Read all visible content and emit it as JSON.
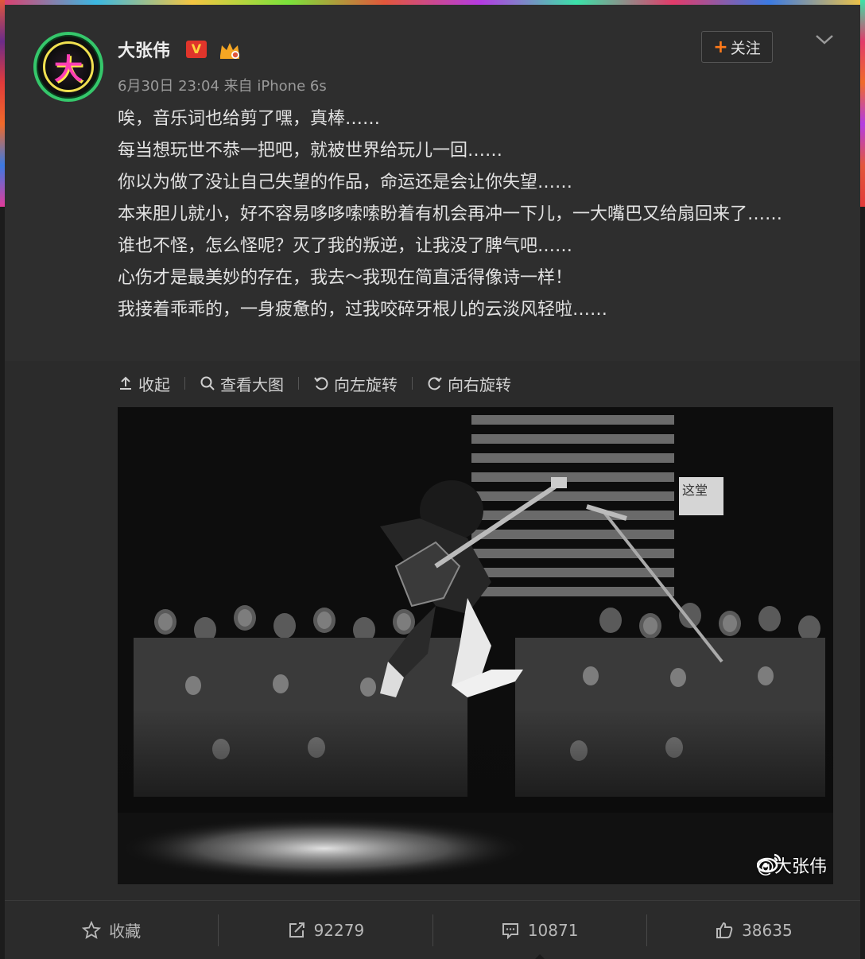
{
  "post": {
    "username": "大张伟",
    "verified_badge": "V",
    "meta": "6月30日 23:04 来自 iPhone 6s",
    "follow_plus": "+",
    "follow_label": "关注",
    "avatar_char": "大",
    "text_lines": [
      "唉，音乐词也给剪了嘿，真棒……",
      "每当想玩世不恭一把吧，就被世界给玩儿一回……",
      "你以为做了没让自己失望的作品，命运还是会让你失望……",
      "本来胆儿就小，好不容易哆哆嗦嗦盼着有机会再冲一下儿，一大嘴巴又给扇回来了……",
      "谁也不怪，怎么怪呢？灭了我的叛逆，让我没了脾气吧……",
      "心伤才是最美妙的存在，我去～我现在简直活得像诗一样！",
      "我接着乖乖的，一身疲惫的，过我咬碎牙根儿的云淡风轻啦……"
    ]
  },
  "toolbar": {
    "collapse": "收起",
    "view_large": "查看大图",
    "rotate_left": "向左旋转",
    "rotate_right": "向右旋转"
  },
  "photo": {
    "watermark": "@大张伟",
    "sign_text": "这堂"
  },
  "footer": {
    "favorite": "收藏",
    "repost_count": "92279",
    "comment_count": "10871",
    "like_count": "38635"
  },
  "colors": {
    "accent_orange": "#ff7a1a",
    "verified_red": "#e0352b",
    "avatar_ring": "#35c76b"
  },
  "icons": [
    "crown-icon",
    "chevron-down-icon",
    "collapse-icon",
    "search-icon",
    "rotate-left-icon",
    "rotate-right-icon",
    "star-icon",
    "repost-icon",
    "comment-icon",
    "like-icon",
    "weibo-logo-icon"
  ]
}
